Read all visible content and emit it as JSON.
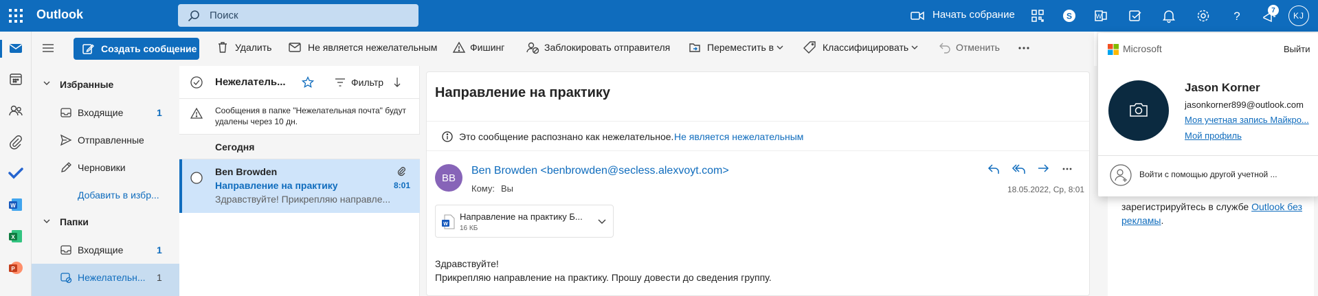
{
  "topbar": {
    "app_name": "Outlook",
    "search_placeholder": "Поиск",
    "meet_now_label": "Начать собрание",
    "notification_count": "7",
    "avatar_initials": "KJ"
  },
  "commands": {
    "new_message": "Создать сообщение",
    "delete": "Удалить",
    "not_junk": "Не является нежелательным",
    "phishing": "Фишинг",
    "block_sender": "Заблокировать отправителя",
    "move_to": "Переместить в",
    "categorize": "Классифицировать",
    "undo": "Отменить"
  },
  "folders": {
    "favorites_header": "Избранные",
    "favorites": [
      {
        "label": "Входящие",
        "count": "1"
      },
      {
        "label": "Отправленные",
        "count": ""
      },
      {
        "label": "Черновики",
        "count": ""
      }
    ],
    "add_favorite": "Добавить в избр...",
    "folders_header": "Папки",
    "folder_items": [
      {
        "label": "Входящие",
        "count": "1"
      },
      {
        "label": "Нежелательн...",
        "count": "1"
      }
    ]
  },
  "list": {
    "title": "Нежелатель...",
    "filter_label": "Фильтр",
    "junk_note": "Сообщения в папке \"Нежелательная почта\" будут удалены через 10 дн.",
    "group_today": "Сегодня",
    "message": {
      "sender": "Ben Browden",
      "subject": "Направление на практику",
      "time": "8:01",
      "preview": "Здравствуйте! Прикрепляю направле..."
    }
  },
  "reading": {
    "subject": "Направление на практику",
    "junk_banner_text": "Это сообщение распознано как нежелательное.",
    "junk_banner_link": "Не является нежелательным",
    "sender_initials": "BB",
    "sender": "Ben Browden <benbrowden@secless.alexvoyt.com>",
    "to_label": "Кому:",
    "to_value": "Вы",
    "date": "18.05.2022, Ср, 8:01",
    "attachment_name": "Направление на практику Б...",
    "attachment_size": "16 КБ",
    "body_line1": "Здравствуйте!",
    "body_line2": "Прикрепляю направление на практику. Прошу довести до сведения группу."
  },
  "promo": {
    "line1": "зарегистрируйтесь в службе",
    "link": "Outlook без",
    "link2": "рекламы",
    "end": "."
  },
  "account": {
    "brand": "Microsoft",
    "sign_out": "Выйти",
    "name": "Jason Korner",
    "email": "jasonkorner899@outlook.com",
    "my_account": "Моя учетная запись Майкро...",
    "my_profile": "Мой профиль",
    "other_account": "Войти с помощью другой учетной ..."
  },
  "colors": {
    "brand_blue": "#0f6cbd",
    "sender_avatar": "#8764b8"
  }
}
